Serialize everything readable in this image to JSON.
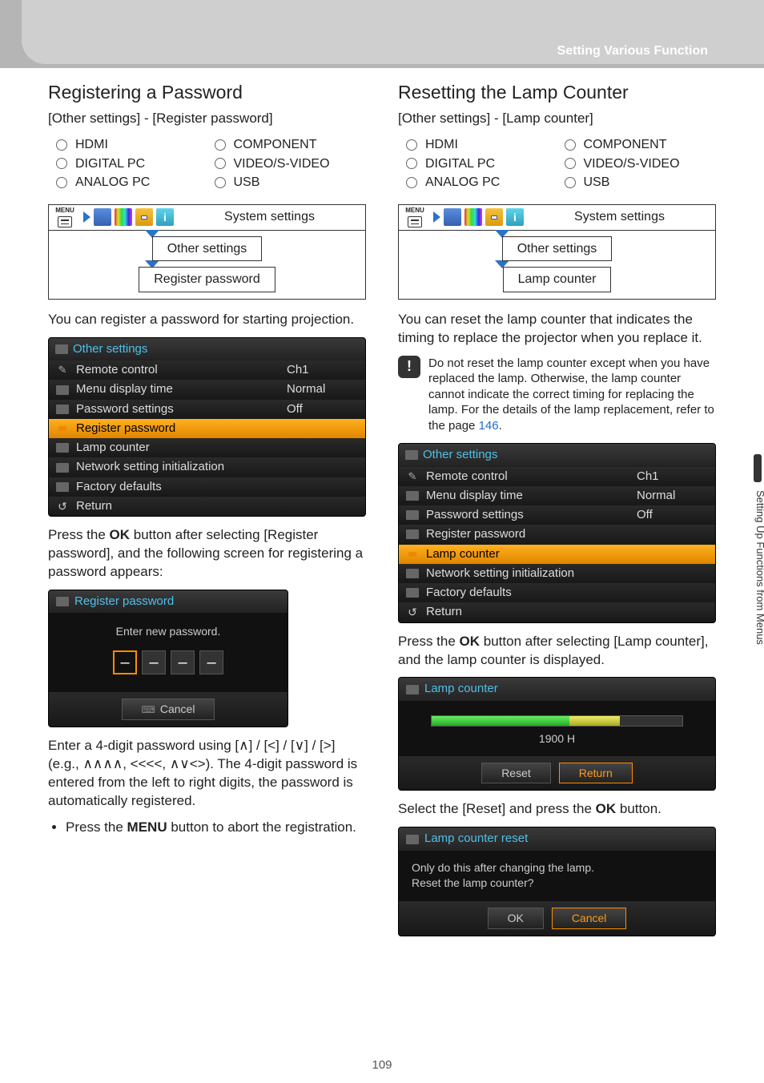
{
  "header": {
    "crumb": "Setting Various Function"
  },
  "side": {
    "tab_label": "Setting Up Functions from Menus"
  },
  "page_number": "109",
  "inputs": [
    "HDMI",
    "COMPONENT",
    "DIGITAL PC",
    "VIDEO/S-VIDEO",
    "ANALOG PC",
    "USB"
  ],
  "nav": {
    "top_label": "System settings",
    "mid_label": "Other settings"
  },
  "left": {
    "heading": "Registering a Password",
    "path": "[Other settings] - [Register password]",
    "nav_bottom": "Register password",
    "intro": "You can register a password for starting projection.",
    "osd_title": "Other settings",
    "rows": [
      {
        "label": "Remote control",
        "value": "Ch1",
        "ico": "mini-gray"
      },
      {
        "label": "Menu display time",
        "value": "Normal",
        "ico": "mini-red"
      },
      {
        "label": "Password settings",
        "value": "Off",
        "ico": "mini-green"
      },
      {
        "label": "Register password",
        "value": "",
        "ico": "mini-orange",
        "hl": true
      },
      {
        "label": "Lamp counter",
        "value": "",
        "ico": "mini-yellow"
      },
      {
        "label": "Network setting initialization",
        "value": "",
        "ico": "mini-blue"
      },
      {
        "label": "Factory defaults",
        "value": "",
        "ico": "mini-gray"
      },
      {
        "label": "Return",
        "value": "",
        "ico": "return"
      }
    ],
    "after_osd_1a": "Press the ",
    "after_osd_1b": "OK",
    "after_osd_1c": " button after selecting [Register password], and the following screen for registering a password appears:",
    "pw_dialog": {
      "title": "Register password",
      "prompt": "Enter new password.",
      "cancel": "Cancel"
    },
    "p3": "Enter a 4-digit password using [∧] / [<] / [∨] / [>] (e.g., ∧∧∧∧, <<<<, ∧∨<>). The 4-digit password is entered from the left to right digits, the password is automatically registered.",
    "bullet_a": "Press the ",
    "bullet_b": "MENU",
    "bullet_c": " button to abort the registration."
  },
  "right": {
    "heading": "Resetting the Lamp Counter",
    "path": "[Other settings] - [Lamp counter]",
    "nav_bottom": "Lamp counter",
    "intro": "You can reset the lamp counter that indicates the timing to replace the projector when you replace it.",
    "note_a": "Do not reset the lamp counter except when you have replaced the lamp. Otherwise, the lamp counter cannot indicate the correct timing for replacing the lamp. For the details of the lamp replacement, refer to the page ",
    "note_link": "146",
    "note_b": ".",
    "osd_title": "Other settings",
    "rows": [
      {
        "label": "Remote control",
        "value": "Ch1",
        "ico": "mini-gray"
      },
      {
        "label": "Menu display time",
        "value": "Normal",
        "ico": "mini-red"
      },
      {
        "label": "Password settings",
        "value": "Off",
        "ico": "mini-green"
      },
      {
        "label": "Register password",
        "value": "",
        "ico": "mini-green"
      },
      {
        "label": "Lamp counter",
        "value": "",
        "ico": "mini-orange",
        "hl": true
      },
      {
        "label": "Network setting initialization",
        "value": "",
        "ico": "mini-blue"
      },
      {
        "label": "Factory defaults",
        "value": "",
        "ico": "mini-gray"
      },
      {
        "label": "Return",
        "value": "",
        "ico": "return"
      }
    ],
    "after_osd_1a": "Press the ",
    "after_osd_1b": "OK",
    "after_osd_1c": " button after selecting [Lamp counter], and the lamp counter is displayed.",
    "lamp_dialog": {
      "title": "Lamp counter",
      "hours": "1900 H",
      "reset": "Reset",
      "return": "Return"
    },
    "p3a": "Select the [Reset] and press the ",
    "p3b": "OK",
    "p3c": " button.",
    "reset_dialog": {
      "title": "Lamp counter reset",
      "line1": "Only do this after changing the lamp.",
      "line2": "Reset the lamp counter?",
      "ok": "OK",
      "cancel": "Cancel"
    }
  }
}
